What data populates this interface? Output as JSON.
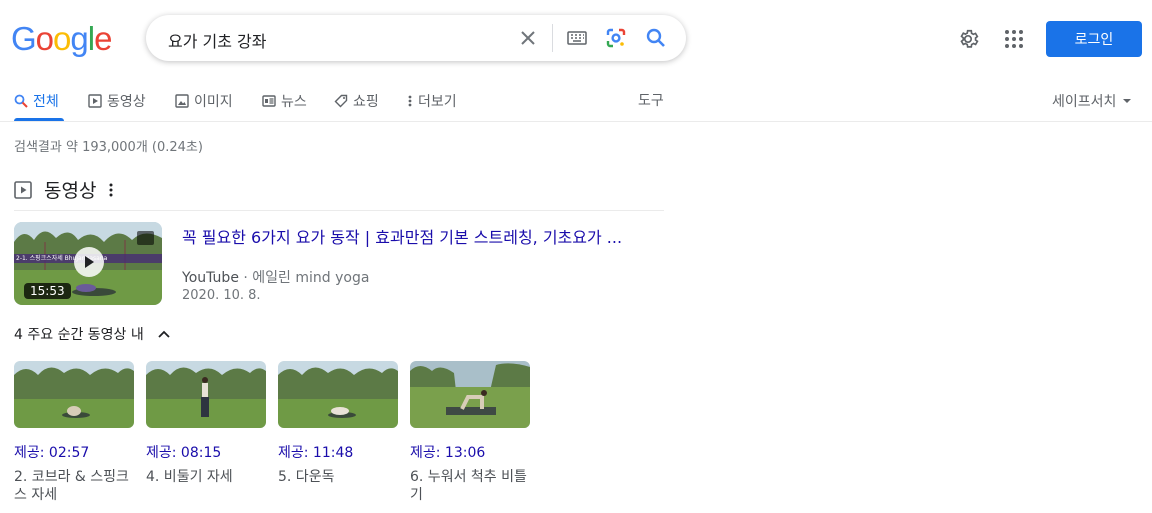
{
  "search": {
    "query": "요가 기초 강좌"
  },
  "header": {
    "login_label": "로그인"
  },
  "tabs": [
    {
      "label": "전체",
      "icon": "search-icon",
      "active": true
    },
    {
      "label": "동영상",
      "icon": "play-icon"
    },
    {
      "label": "이미지",
      "icon": "image-icon"
    },
    {
      "label": "뉴스",
      "icon": "news-icon"
    },
    {
      "label": "쇼핑",
      "icon": "tag-icon"
    },
    {
      "label": "더보기",
      "icon": "more-vert-icon"
    }
  ],
  "tools_label": "도구",
  "safesearch_label": "세이프서치",
  "result_stats": "검색결과 약 193,000개 (0.24초)",
  "videos": {
    "section_title": "동영상",
    "main": {
      "title": "꼭 필요한 6가지 요가 동작 | 효과만점 기본 스트레칭, 기초요가 ...",
      "source": "YouTube",
      "channel": "에일린 mind yoga",
      "date": "2020. 10. 8.",
      "duration": "15:53",
      "banner": "2-1. 스핑크스자세 Bhujangasana"
    },
    "moments_label": "4 주요 순간 동영상 내",
    "moments": [
      {
        "time": "제공: 02:57",
        "caption": "2. 코브라 & 스핑크스 자세"
      },
      {
        "time": "제공: 08:15",
        "caption": "4. 비둘기 자세"
      },
      {
        "time": "제공: 11:48",
        "caption": "5. 다운독"
      },
      {
        "time": "제공: 13:06",
        "caption": "6. 누워서 척추 비틀기"
      }
    ]
  },
  "colors": {
    "accent": "#1a73e8",
    "link": "#1a0dab"
  }
}
